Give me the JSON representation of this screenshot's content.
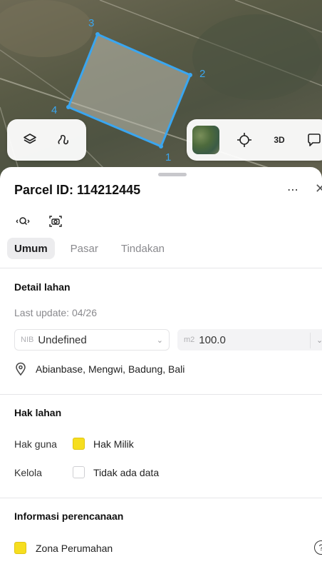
{
  "map": {
    "vertex_labels": [
      "1",
      "2",
      "3",
      "4"
    ],
    "controls": {
      "layers_icon": "layers-icon",
      "draw_icon": "draw-path-icon",
      "locate_icon": "crosshair-icon",
      "mode_3d_label": "3D",
      "chat_icon": "chat-question-icon"
    },
    "parcel_color": "#3aa6f0"
  },
  "sheet": {
    "title": "Parcel ID: 114212445",
    "more_label": "⋯",
    "close_label": "✕",
    "tabs": [
      {
        "label": "Umum",
        "active": true
      },
      {
        "label": "Pasar",
        "active": false
      },
      {
        "label": "Tindakan",
        "active": false
      }
    ],
    "detail": {
      "heading": "Detail lahan",
      "last_update": "Last update: 04/26",
      "nib_prefix": "NIB",
      "nib_value": "Undefined",
      "area_prefix": "m2",
      "area_value": "100.0",
      "address": "Abianbase, Mengwi, Badung, Bali"
    },
    "rights": {
      "heading": "Hak lahan",
      "rows": [
        {
          "label": "Hak guna",
          "value": "Hak Milik",
          "swatch": "#f6de1f"
        },
        {
          "label": "Kelola",
          "value": "Tidak ada data",
          "swatch": "#ffffff"
        }
      ]
    },
    "planning": {
      "heading": "Informasi perencanaan",
      "zone": "Zona Perumahan",
      "zone_color": "#f6de1f"
    }
  }
}
